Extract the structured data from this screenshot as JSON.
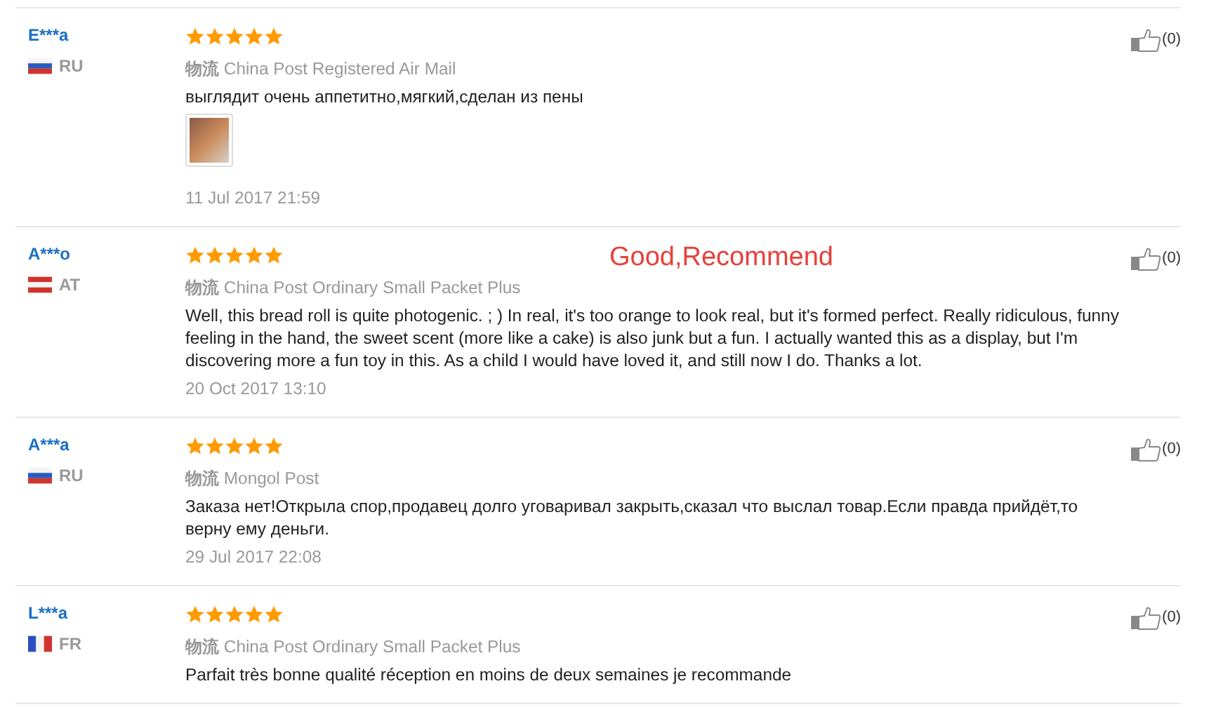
{
  "overlay_caption": "Good,Recommend",
  "reviews": [
    {
      "user": "E***a",
      "country": "RU",
      "flag": {
        "kind": "horizontal",
        "stripes": [
          {
            "color": "#f4f4f4"
          },
          {
            "color": "#2a5bc0"
          },
          {
            "color": "#d0342c"
          }
        ]
      },
      "stars": 5,
      "shipping_label": "物流",
      "shipping": "China Post Registered Air Mail",
      "text": "выглядит очень аппетитно,мягкий,сделан из пены",
      "photos": [
        {
          "kind": "thumbnail"
        }
      ],
      "date": "11 Jul 2017 21:59",
      "likes": "(0)"
    },
    {
      "user": "A***o",
      "country": "AT",
      "flag": {
        "kind": "horizontal",
        "stripes": [
          {
            "color": "#d0342c"
          },
          {
            "color": "#f4f4f4"
          },
          {
            "color": "#d0342c"
          }
        ]
      },
      "stars": 5,
      "shipping_label": "物流",
      "shipping": "China Post Ordinary Small Packet Plus",
      "text": "Well, this bread roll is quite photogenic. ; ) In real, it's too orange to look real, but it's formed perfect. Really ridiculous, funny feeling in the hand, the sweet scent (more like a cake) is also junk but a fun. I actually wanted this as a display, but I'm discovering more a fun toy in this. As a child I would have loved it, and still now I do. Thanks a lot.",
      "date": "20 Oct 2017 13:10",
      "likes": "(0)"
    },
    {
      "user": "A***a",
      "country": "RU",
      "flag": {
        "kind": "horizontal",
        "stripes": [
          {
            "color": "#f4f4f4"
          },
          {
            "color": "#2a5bc0"
          },
          {
            "color": "#d0342c"
          }
        ]
      },
      "stars": 5,
      "shipping_label": "物流",
      "shipping": "Mongol Post",
      "text": "Заказа нет!Открыла спор,продавец долго уговаривал закрыть,сказал что выслал товар.Если правда прийдёт,то верну ему деньги.",
      "date": "29 Jul 2017 22:08",
      "likes": "(0)"
    },
    {
      "user": "L***a",
      "country": "FR",
      "flag": {
        "kind": "vertical",
        "stripes": [
          {
            "color": "#2a4fc0"
          },
          {
            "color": "#f4f4f4"
          },
          {
            "color": "#d0342c"
          }
        ]
      },
      "stars": 5,
      "shipping_label": "物流",
      "shipping": "China Post Ordinary Small Packet Plus",
      "text": "Parfait très bonne qualité réception en moins de deux semaines je recommande",
      "likes": "(0)"
    }
  ]
}
